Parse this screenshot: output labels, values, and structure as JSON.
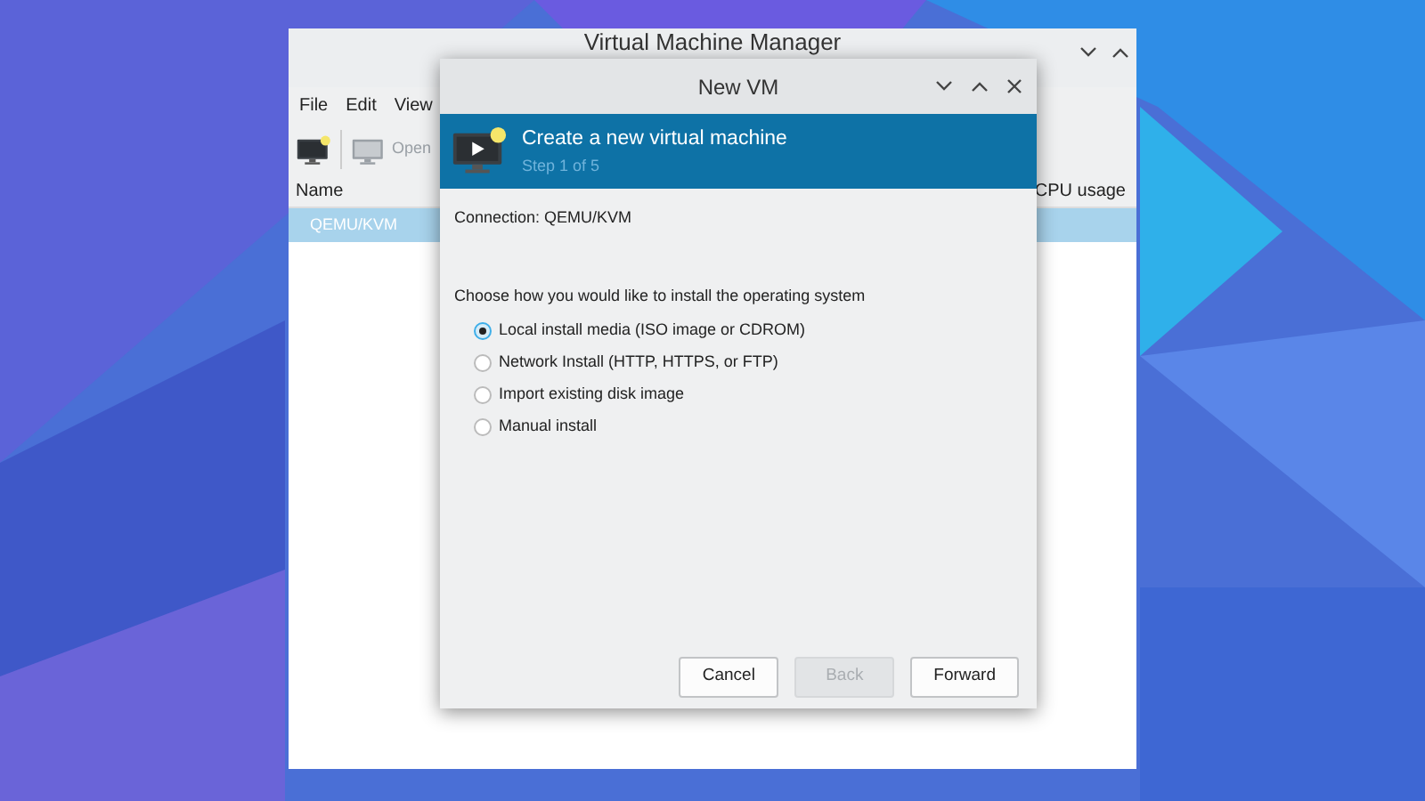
{
  "main_window": {
    "title": "Virtual Machine Manager",
    "menu": [
      "File",
      "Edit",
      "View"
    ],
    "toolbar": [
      {
        "kind": "new",
        "disabled": false
      },
      {
        "kind": "open",
        "label": "Open",
        "disabled": true
      }
    ],
    "columns": [
      "Name",
      "CPU usage"
    ],
    "rows": [
      {
        "name": "QEMU/KVM",
        "selected": true
      }
    ]
  },
  "dialog": {
    "title": "New VM",
    "header": {
      "title": "Create a new virtual machine",
      "step": "Step 1 of 5"
    },
    "connection": "Connection:  QEMU/KVM",
    "prompt": "Choose how you would like to install the operating system",
    "options": [
      {
        "label": "Local install media (ISO image or CDROM)",
        "selected": true
      },
      {
        "label": "Network Install (HTTP, HTTPS, or FTP)",
        "selected": false
      },
      {
        "label": "Import existing disk image",
        "selected": false
      },
      {
        "label": "Manual install",
        "selected": false
      }
    ],
    "buttons": [
      {
        "label": "Cancel",
        "disabled": false
      },
      {
        "label": "Back",
        "disabled": true
      },
      {
        "label": "Forward",
        "disabled": false
      }
    ]
  }
}
